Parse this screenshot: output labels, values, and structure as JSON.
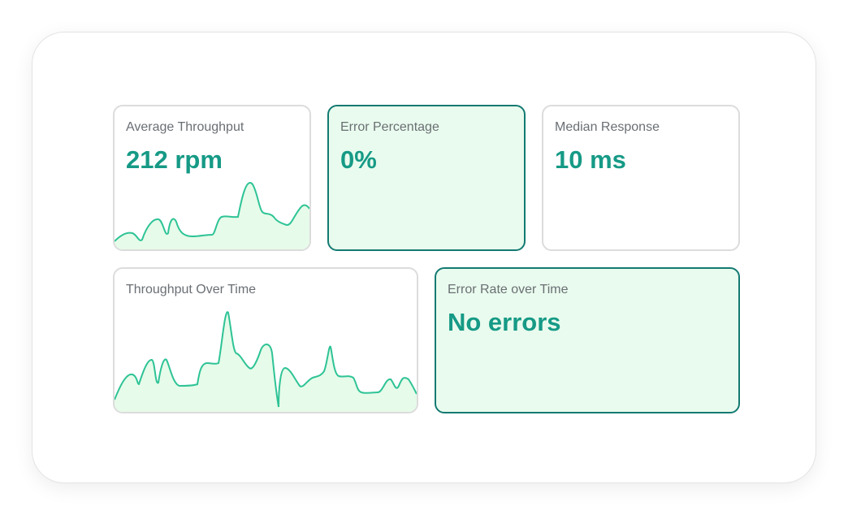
{
  "cards": {
    "avg_throughput": {
      "title": "Average Throughput",
      "value": "212 rpm"
    },
    "error_percentage": {
      "title": "Error Percentage",
      "value": "0%"
    },
    "median_response": {
      "title": "Median Response",
      "value": "10 ms"
    },
    "throughput_over_time": {
      "title": "Throughput Over Time"
    },
    "error_rate_over_time": {
      "title": "Error Rate over Time",
      "value": "No errors"
    }
  },
  "colors": {
    "accent_text": "#169a86",
    "line": "#2ec396",
    "fill": "#e6fbe9",
    "highlight_border": "#137a72",
    "highlight_bg": "#e9fbee",
    "border": "#dcdcdc",
    "title_text": "#6a6f74"
  }
}
